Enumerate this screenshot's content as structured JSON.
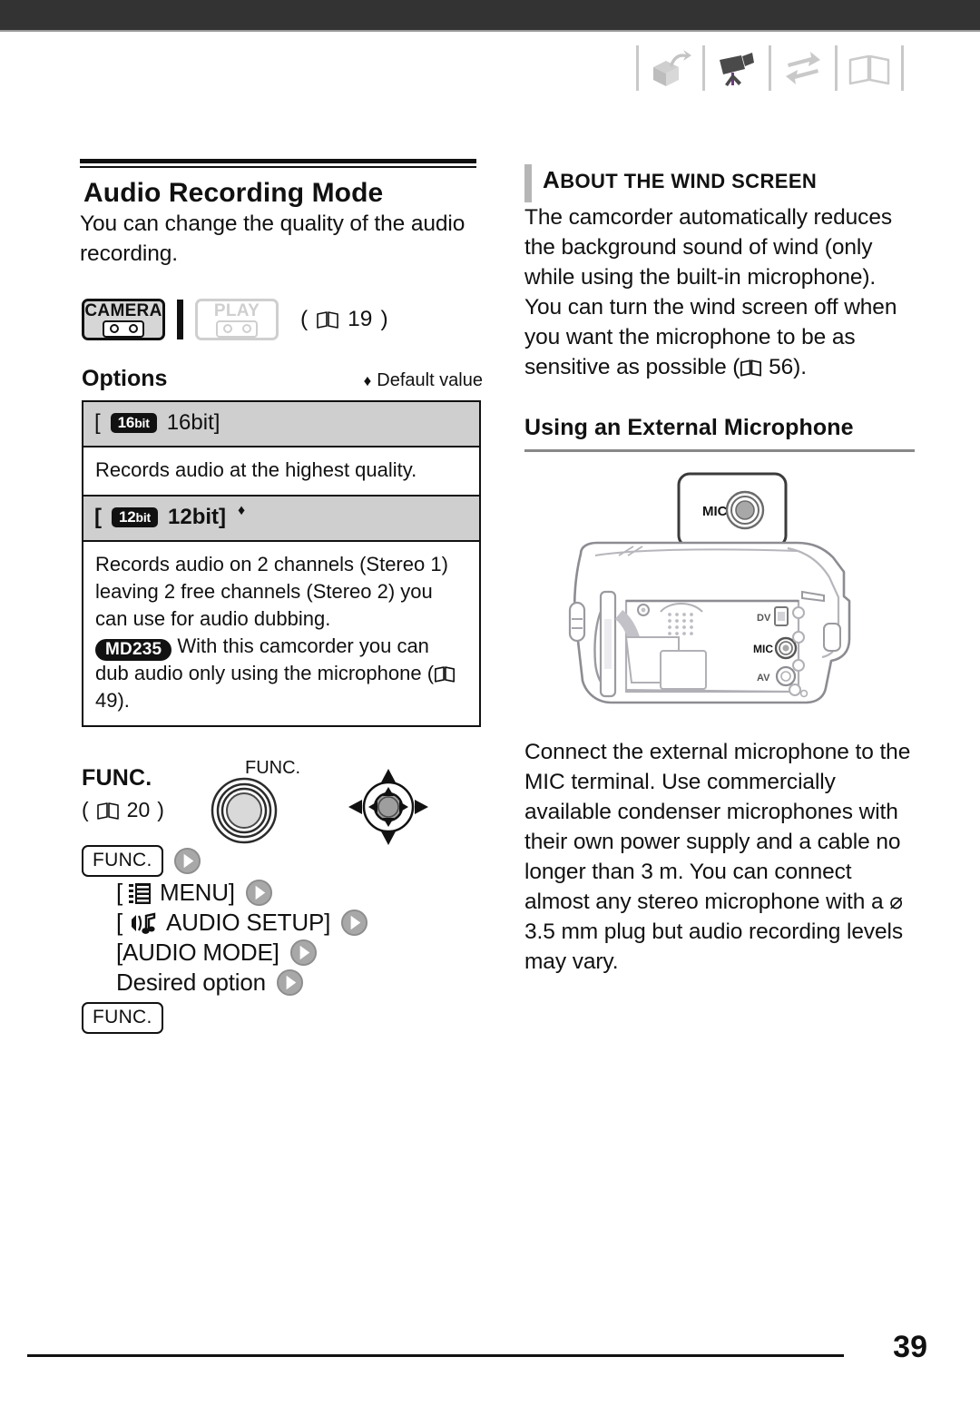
{
  "header": {
    "icons": [
      {
        "name": "unpacking-icon",
        "state": "inactive"
      },
      {
        "name": "camcorder-icon",
        "state": "active"
      },
      {
        "name": "transfer-arrows-icon",
        "state": "inactive"
      },
      {
        "name": "open-book-icon",
        "state": "inactive"
      }
    ]
  },
  "left": {
    "title": "Audio Recording Mode",
    "intro": "You can change the quality of the audio recording.",
    "modes": {
      "camera_label": "CAMERA",
      "play_label": "PLAY",
      "page_ref": "19",
      "page_ref_prefix": "(",
      "page_ref_suffix": ")"
    },
    "options": {
      "heading": "Options",
      "default_marker": "♦",
      "default_label": "Default value",
      "rows": [
        {
          "badge": "16bit",
          "badge_main": "16",
          "badge_sub": "bit",
          "label": "[",
          "name": "16bit]",
          "bold": false,
          "default": false,
          "description": "Records audio at the highest quality."
        },
        {
          "badge": "12bit",
          "badge_main": "12",
          "badge_sub": "bit",
          "label": "[",
          "name": "12bit]",
          "bold": true,
          "default": true,
          "description": "Records audio on 2 channels (Stereo 1) leaving 2 free channels (Stereo 2) you can use for audio dubbing.",
          "model_badge": "MD235",
          "description2_pre": "With this camcorder you can dub audio only using the microphone (",
          "description2_page": "49",
          "description2_post": ")."
        }
      ]
    },
    "func": {
      "label": "FUNC.",
      "page_ref": "20",
      "dial_caption": "FUNC.",
      "steps": [
        {
          "type": "button",
          "text": "FUNC.",
          "arrow": true,
          "indent": false
        },
        {
          "type": "text",
          "text": "[",
          "icon": "menu-icon",
          "text_after": "MENU]",
          "arrow": true,
          "indent": true
        },
        {
          "type": "text",
          "text": "[",
          "icon": "audio-note-icon",
          "text_after": "AUDIO SETUP]",
          "arrow": true,
          "indent": true
        },
        {
          "type": "text",
          "text": "[AUDIO MODE]",
          "arrow": true,
          "indent": true
        },
        {
          "type": "text",
          "text": "Desired option",
          "arrow": true,
          "indent": true
        },
        {
          "type": "button",
          "text": "FUNC.",
          "arrow": false,
          "indent": false
        }
      ]
    }
  },
  "right": {
    "note": {
      "title_first": "A",
      "title_rest": "BOUT THE WIND SCREEN",
      "title_full": "ABOUT THE WIND SCREEN",
      "body": "The camcorder automatically reduces the background sound of wind (only while using the built-in microphone). You can turn the wind screen off when you want the microphone to be as sensitive as possible (",
      "body_page": "56",
      "body_post": ")."
    },
    "subtitle": "Using an External Microphone",
    "figure": {
      "callout_label": "MIC",
      "terminal_dv": "DV",
      "terminal_mic": "MIC",
      "terminal_av": "AV"
    },
    "tail": "Connect the external microphone to the MIC terminal. Use commercially available condenser microphones with their own power supply and a cable no longer than 3 m. You can connect almost any stereo microphone with a ⌀ 3.5  mm plug but audio recording levels may vary."
  },
  "footer": {
    "page_number": "39"
  },
  "colors": {
    "topbar": "#333333",
    "table_header": "#cfcfcf",
    "badge_black": "#111111",
    "note_bar": "#b6b6b6",
    "arrow_button": "#9a9a9a"
  }
}
